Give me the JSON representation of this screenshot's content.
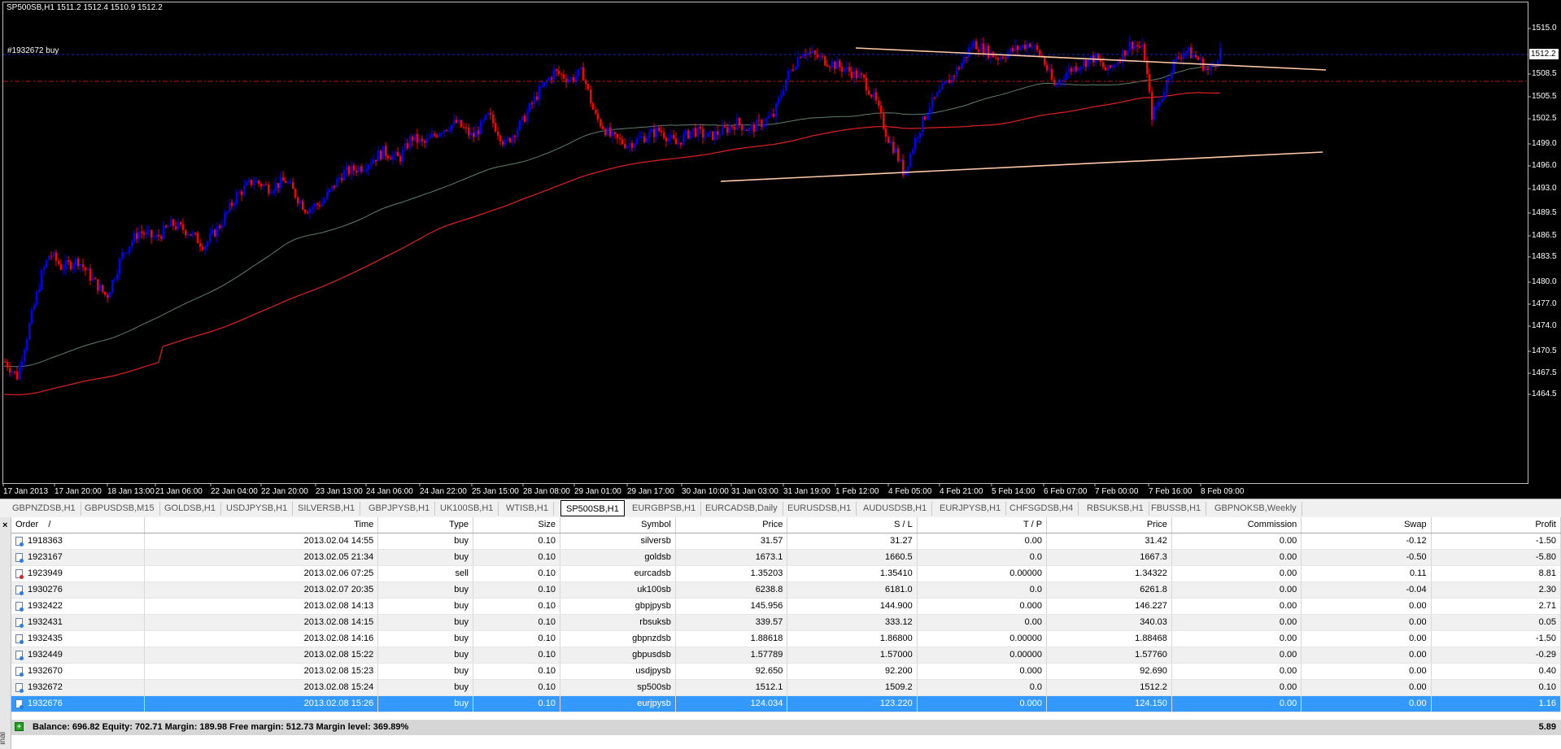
{
  "chart": {
    "header": "SP500SB,H1  1511.2 1512.4 1510.9 1512.2",
    "order_label": "#1932672 buy",
    "current_price": "1512.2",
    "price_labels": [
      "1515.0",
      "1508.5",
      "1505.5",
      "1502.5",
      "1499.0",
      "1496.0",
      "1493.0",
      "1489.5",
      "1486.5",
      "1483.5",
      "1480.0",
      "1477.0",
      "1474.0",
      "1470.5",
      "1467.5",
      "1464.5"
    ],
    "time_labels": [
      "17 Jan 2013",
      "17 Jan 20:00",
      "18 Jan 13:00",
      "21 Jan 06:00",
      "22 Jan 04:00",
      "22 Jan 20:00",
      "23 Jan 13:00",
      "24 Jan 06:00",
      "24 Jan 22:00",
      "25 Jan 15:00",
      "28 Jan 08:00",
      "29 Jan 01:00",
      "29 Jan 17:00",
      "30 Jan 10:00",
      "31 Jan 03:00",
      "31 Jan 19:00",
      "1 Feb 12:00",
      "4 Feb 05:00",
      "4 Feb 21:00",
      "5 Feb 14:00",
      "6 Feb 07:00",
      "7 Feb 00:00",
      "7 Feb 16:00",
      "8 Feb 09:00"
    ],
    "colors": {
      "bull": "#0000ff",
      "bear": "#ff0000",
      "ma_slow": "#e02020",
      "ma_fast": "#5f7f6a",
      "trendline": "#ffc8a8",
      "bid_line": "#1e2aa8",
      "order_line": "#b81818"
    }
  },
  "tabs": [
    "GBPNZDSB,H1",
    "GBPUSDSB,M15",
    "GOLDSB,H1",
    "USDJPYSB,H1",
    "SILVERSB,H1",
    "GBPJPYSB,H1",
    "UK100SB,H1",
    "WTISB,H1",
    "SP500SB,H1",
    "EURGBPSB,H1",
    "EURCADSB,Daily",
    "EURUSDSB,H1",
    "AUDUSDSB,H1",
    "EURJPYSB,H1",
    "CHFSGDSB,H4",
    "RBSUKSB,H1",
    "FBUSSB,H1",
    "GBPNOKSB,Weekly"
  ],
  "active_tab": "SP500SB,H1",
  "terminal": {
    "close": "×",
    "label": "inal",
    "headers": {
      "order": "Order",
      "sort": "/",
      "time": "Time",
      "type": "Type",
      "size": "Size",
      "symbol": "Symbol",
      "price": "Price",
      "sl": "S / L",
      "tp": "T / P",
      "cur_price": "Price",
      "commission": "Commission",
      "swap": "Swap",
      "profit": "Profit"
    },
    "rows": [
      {
        "order": "1918363",
        "time": "2013.02.04 14:55",
        "type": "buy",
        "size": "0.10",
        "symbol": "silversb",
        "price": "31.57",
        "sl": "31.27",
        "tp": "0.00",
        "cur_price": "31.42",
        "commission": "0.00",
        "swap": "-0.12",
        "profit": "-1.50"
      },
      {
        "order": "1923167",
        "time": "2013.02.05 21:34",
        "type": "buy",
        "size": "0.10",
        "symbol": "goldsb",
        "price": "1673.1",
        "sl": "1660.5",
        "tp": "0.0",
        "cur_price": "1667.3",
        "commission": "0.00",
        "swap": "-0.50",
        "profit": "-5.80"
      },
      {
        "order": "1923949",
        "time": "2013.02.06 07:25",
        "type": "sell",
        "size": "0.10",
        "symbol": "eurcadsb",
        "price": "1.35203",
        "sl": "1.35410",
        "tp": "0.00000",
        "cur_price": "1.34322",
        "commission": "0.00",
        "swap": "0.11",
        "profit": "8.81"
      },
      {
        "order": "1930276",
        "time": "2013.02.07 20:35",
        "type": "buy",
        "size": "0.10",
        "symbol": "uk100sb",
        "price": "6238.8",
        "sl": "6181.0",
        "tp": "0.0",
        "cur_price": "6261.8",
        "commission": "0.00",
        "swap": "-0.04",
        "profit": "2.30"
      },
      {
        "order": "1932422",
        "time": "2013.02.08 14:13",
        "type": "buy",
        "size": "0.10",
        "symbol": "gbpjpysb",
        "price": "145.956",
        "sl": "144.900",
        "tp": "0.000",
        "cur_price": "146.227",
        "commission": "0.00",
        "swap": "0.00",
        "profit": "2.71"
      },
      {
        "order": "1932431",
        "time": "2013.02.08 14:15",
        "type": "buy",
        "size": "0.10",
        "symbol": "rbsuksb",
        "price": "339.57",
        "sl": "333.12",
        "tp": "0.00",
        "cur_price": "340.03",
        "commission": "0.00",
        "swap": "0.00",
        "profit": "0.05"
      },
      {
        "order": "1932435",
        "time": "2013.02.08 14:16",
        "type": "buy",
        "size": "0.10",
        "symbol": "gbpnzdsb",
        "price": "1.88618",
        "sl": "1.86800",
        "tp": "0.00000",
        "cur_price": "1.88468",
        "commission": "0.00",
        "swap": "0.00",
        "profit": "-1.50"
      },
      {
        "order": "1932449",
        "time": "2013.02.08 15:22",
        "type": "buy",
        "size": "0.10",
        "symbol": "gbpusdsb",
        "price": "1.57789",
        "sl": "1.57000",
        "tp": "0.00000",
        "cur_price": "1.57760",
        "commission": "0.00",
        "swap": "0.00",
        "profit": "-0.29"
      },
      {
        "order": "1932670",
        "time": "2013.02.08 15:23",
        "type": "buy",
        "size": "0.10",
        "symbol": "usdjpysb",
        "price": "92.650",
        "sl": "92.200",
        "tp": "0.000",
        "cur_price": "92.690",
        "commission": "0.00",
        "swap": "0.00",
        "profit": "0.40"
      },
      {
        "order": "1932672",
        "time": "2013.02.08 15:24",
        "type": "buy",
        "size": "0.10",
        "symbol": "sp500sb",
        "price": "1512.1",
        "sl": "1509.2",
        "tp": "0.0",
        "cur_price": "1512.2",
        "commission": "0.00",
        "swap": "0.00",
        "profit": "0.10"
      },
      {
        "order": "1932676",
        "time": "2013.02.08 15:26",
        "type": "buy",
        "size": "0.10",
        "symbol": "eurjpysb",
        "price": "124.034",
        "sl": "123.220",
        "tp": "0.000",
        "cur_price": "124.150",
        "commission": "0.00",
        "swap": "0.00",
        "profit": "1.16"
      }
    ],
    "selected_row": 10,
    "balance_text": "Balance: 696.82  Equity: 702.71  Margin: 189.98  Free margin: 512.73  Margin level: 369.89%",
    "balance_profit": "5.89"
  }
}
